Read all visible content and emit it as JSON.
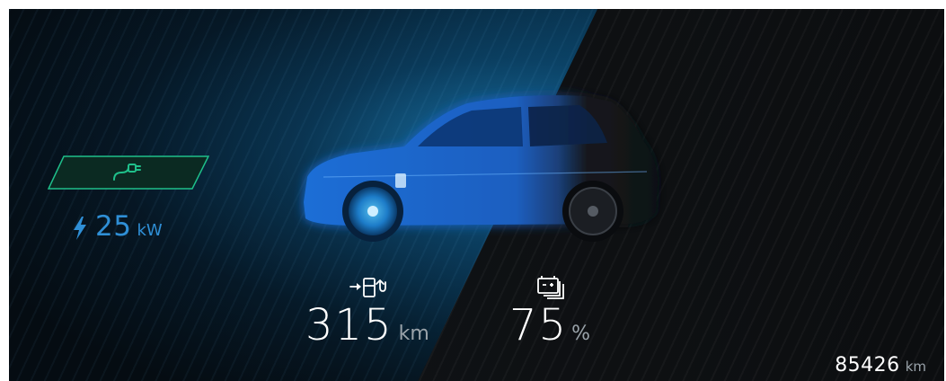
{
  "charging": {
    "plug_icon": "charging-plug-icon",
    "bolt_icon": "lightning-bolt-icon",
    "power_value": "25",
    "power_unit": "kW"
  },
  "range": {
    "icon": "range-to-fuel-station-icon",
    "value": "315",
    "unit": "km"
  },
  "battery": {
    "icon": "battery-icon",
    "value": "75",
    "unit": "%"
  },
  "odometer": {
    "value": "85426",
    "unit": "km"
  },
  "colors": {
    "accent_blue": "#2f8fd6",
    "charge_green": "#1fbf8a",
    "background": "#0a0c0e",
    "text_primary": "#ffffff",
    "text_unit": "#9aa3aa"
  }
}
